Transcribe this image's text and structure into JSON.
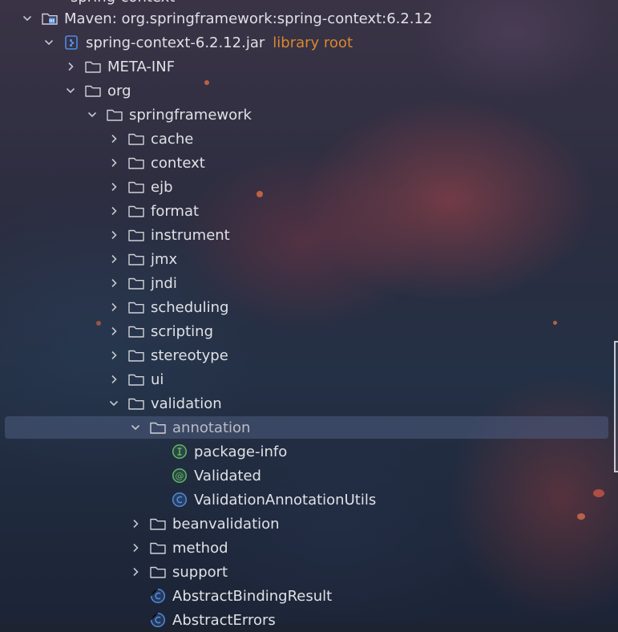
{
  "top_partial": {
    "label": "spring-context"
  },
  "tree": [
    {
      "id": "maven",
      "indent": 0,
      "expanded": true,
      "icon": "maven-library-icon",
      "label": "Maven: org.springframework:spring-context:6.2.12"
    },
    {
      "id": "jar",
      "indent": 1,
      "expanded": true,
      "icon": "jar-icon",
      "label": "spring-context-6.2.12.jar",
      "suffix": "library root"
    },
    {
      "id": "meta-inf",
      "indent": 2,
      "expanded": false,
      "icon": "folder-icon",
      "label": "META-INF"
    },
    {
      "id": "org",
      "indent": 2,
      "expanded": true,
      "icon": "folder-icon",
      "label": "org"
    },
    {
      "id": "springframework",
      "indent": 3,
      "expanded": true,
      "icon": "folder-icon",
      "label": "springframework"
    },
    {
      "id": "cache",
      "indent": 4,
      "expanded": false,
      "icon": "folder-icon",
      "label": "cache"
    },
    {
      "id": "context",
      "indent": 4,
      "expanded": false,
      "icon": "folder-icon",
      "label": "context"
    },
    {
      "id": "ejb",
      "indent": 4,
      "expanded": false,
      "icon": "folder-icon",
      "label": "ejb"
    },
    {
      "id": "format",
      "indent": 4,
      "expanded": false,
      "icon": "folder-icon",
      "label": "format"
    },
    {
      "id": "instrument",
      "indent": 4,
      "expanded": false,
      "icon": "folder-icon",
      "label": "instrument"
    },
    {
      "id": "jmx",
      "indent": 4,
      "expanded": false,
      "icon": "folder-icon",
      "label": "jmx"
    },
    {
      "id": "jndi",
      "indent": 4,
      "expanded": false,
      "icon": "folder-icon",
      "label": "jndi"
    },
    {
      "id": "scheduling",
      "indent": 4,
      "expanded": false,
      "icon": "folder-icon",
      "label": "scheduling"
    },
    {
      "id": "scripting",
      "indent": 4,
      "expanded": false,
      "icon": "folder-icon",
      "label": "scripting"
    },
    {
      "id": "stereotype",
      "indent": 4,
      "expanded": false,
      "icon": "folder-icon",
      "label": "stereotype"
    },
    {
      "id": "ui",
      "indent": 4,
      "expanded": false,
      "icon": "folder-icon",
      "label": "ui"
    },
    {
      "id": "validation",
      "indent": 4,
      "expanded": true,
      "icon": "folder-icon",
      "label": "validation"
    },
    {
      "id": "annotation",
      "indent": 5,
      "expanded": true,
      "icon": "folder-icon",
      "label": "annotation",
      "selected": true
    },
    {
      "id": "package-info",
      "indent": 6,
      "leaf": true,
      "icon": "interface-info-icon",
      "label": "package-info"
    },
    {
      "id": "validated",
      "indent": 6,
      "leaf": true,
      "icon": "annotation-type-icon",
      "label": "Validated"
    },
    {
      "id": "vau",
      "indent": 6,
      "leaf": true,
      "icon": "class-icon",
      "label": "ValidationAnnotationUtils"
    },
    {
      "id": "beanvalidation",
      "indent": 5,
      "expanded": false,
      "icon": "folder-icon",
      "label": "beanvalidation"
    },
    {
      "id": "method",
      "indent": 5,
      "expanded": false,
      "icon": "folder-icon",
      "label": "method"
    },
    {
      "id": "support",
      "indent": 5,
      "expanded": false,
      "icon": "folder-icon",
      "label": "support"
    },
    {
      "id": "abr",
      "indent": 5,
      "leaf": true,
      "icon": "abstract-class-icon",
      "label": "AbstractBindingResult"
    },
    {
      "id": "ae",
      "indent": 5,
      "leaf": true,
      "icon": "abstract-class-icon",
      "label": "AbstractErrors"
    }
  ],
  "colors": {
    "text": "#dfe1e5",
    "library_root": "#d9882e",
    "selection": "#4e5c80",
    "green_icon": "#5fb865",
    "blue_icon": "#4f8be0"
  }
}
